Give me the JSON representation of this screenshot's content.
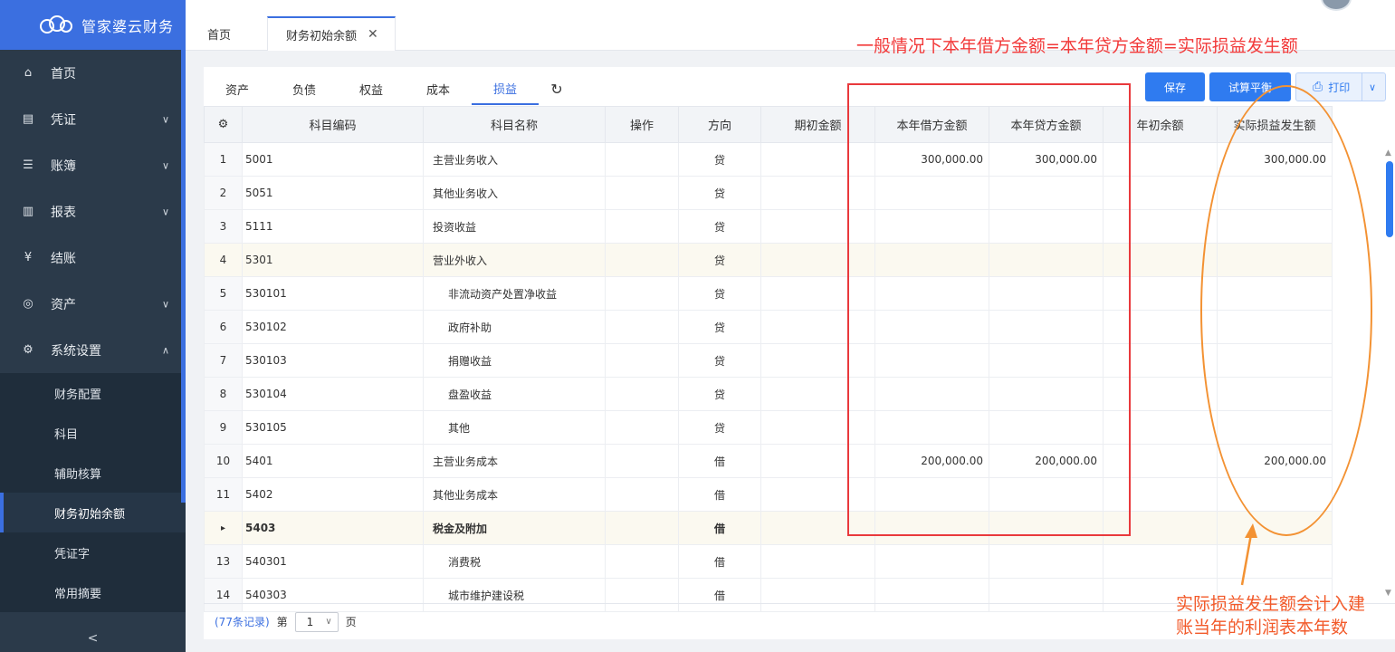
{
  "brand": {
    "name": "管家婆云财务"
  },
  "sidebar": {
    "items": [
      {
        "label": "首页",
        "icon": "home-icon",
        "chevron": ""
      },
      {
        "label": "凭证",
        "icon": "voucher-icon",
        "chevron": "∨"
      },
      {
        "label": "账簿",
        "icon": "ledger-icon",
        "chevron": "∨"
      },
      {
        "label": "报表",
        "icon": "chart-icon",
        "chevron": "∨"
      },
      {
        "label": "结账",
        "icon": "yen-icon",
        "chevron": ""
      },
      {
        "label": "资产",
        "icon": "asset-icon",
        "chevron": "∨"
      },
      {
        "label": "系统设置",
        "icon": "gear-icon",
        "chevron": "∧"
      }
    ],
    "subitems": [
      {
        "label": "财务配置"
      },
      {
        "label": "科目"
      },
      {
        "label": "辅助核算"
      },
      {
        "label": "财务初始余额"
      },
      {
        "label": "凭证字"
      },
      {
        "label": "常用摘要"
      }
    ],
    "collapse_glyph": "<"
  },
  "tabs": {
    "home": "首页",
    "current": "财务初始余额",
    "close_glyph": "✕"
  },
  "subtabs": [
    "资产",
    "负债",
    "权益",
    "成本",
    "损益"
  ],
  "buttons": {
    "save": "保存",
    "trial": "试算平衡",
    "print": "打印"
  },
  "table": {
    "headers": [
      "科目编码",
      "科目名称",
      "操作",
      "方向",
      "期初金额",
      "本年借方金额",
      "本年贷方金额",
      "年初余额",
      "实际损益发生额"
    ],
    "rows": [
      {
        "idx": "1",
        "code": "5001",
        "name": "主营业务收入",
        "dir": "贷",
        "debit": "300,000.00",
        "credit": "300,000.00",
        "actual": "300,000.00"
      },
      {
        "idx": "2",
        "code": "5051",
        "name": "其他业务收入",
        "dir": "贷",
        "debit": "",
        "credit": "",
        "actual": ""
      },
      {
        "idx": "3",
        "code": "5111",
        "name": "投资收益",
        "dir": "贷",
        "debit": "",
        "credit": "",
        "actual": ""
      },
      {
        "idx": "4",
        "code": "5301",
        "name": "营业外收入",
        "dir": "贷",
        "debit": "",
        "credit": "",
        "actual": ""
      },
      {
        "idx": "5",
        "code": "530101",
        "name": "非流动资产处置净收益",
        "dir": "贷",
        "debit": "",
        "credit": "",
        "actual": ""
      },
      {
        "idx": "6",
        "code": "530102",
        "name": "政府补助",
        "dir": "贷",
        "debit": "",
        "credit": "",
        "actual": ""
      },
      {
        "idx": "7",
        "code": "530103",
        "name": "捐赠收益",
        "dir": "贷",
        "debit": "",
        "credit": "",
        "actual": ""
      },
      {
        "idx": "8",
        "code": "530104",
        "name": "盘盈收益",
        "dir": "贷",
        "debit": "",
        "credit": "",
        "actual": ""
      },
      {
        "idx": "9",
        "code": "530105",
        "name": "其他",
        "dir": "贷",
        "debit": "",
        "credit": "",
        "actual": ""
      },
      {
        "idx": "10",
        "code": "5401",
        "name": "主营业务成本",
        "dir": "借",
        "debit": "200,000.00",
        "credit": "200,000.00",
        "actual": "200,000.00"
      },
      {
        "idx": "11",
        "code": "5402",
        "name": "其他业务成本",
        "dir": "借",
        "debit": "",
        "credit": "",
        "actual": ""
      },
      {
        "idx": "▸",
        "code": "5403",
        "name": "税金及附加",
        "dir": "借",
        "debit": "",
        "credit": "",
        "actual": ""
      },
      {
        "idx": "13",
        "code": "540301",
        "name": "消费税",
        "dir": "借",
        "debit": "",
        "credit": "",
        "actual": ""
      },
      {
        "idx": "14",
        "code": "540303",
        "name": "城市维护建设税",
        "dir": "借",
        "debit": "",
        "credit": "",
        "actual": ""
      }
    ]
  },
  "pager": {
    "count": "(77条记录)",
    "prefix": "第",
    "page": "1",
    "suffix": "页"
  },
  "annotations": {
    "top": "一般情况下本年借方金额=本年贷方金额=实际损益发生额",
    "bottom_line1": "实际损益发生额会计入建",
    "bottom_line2": "账当年的利润表本年数"
  }
}
